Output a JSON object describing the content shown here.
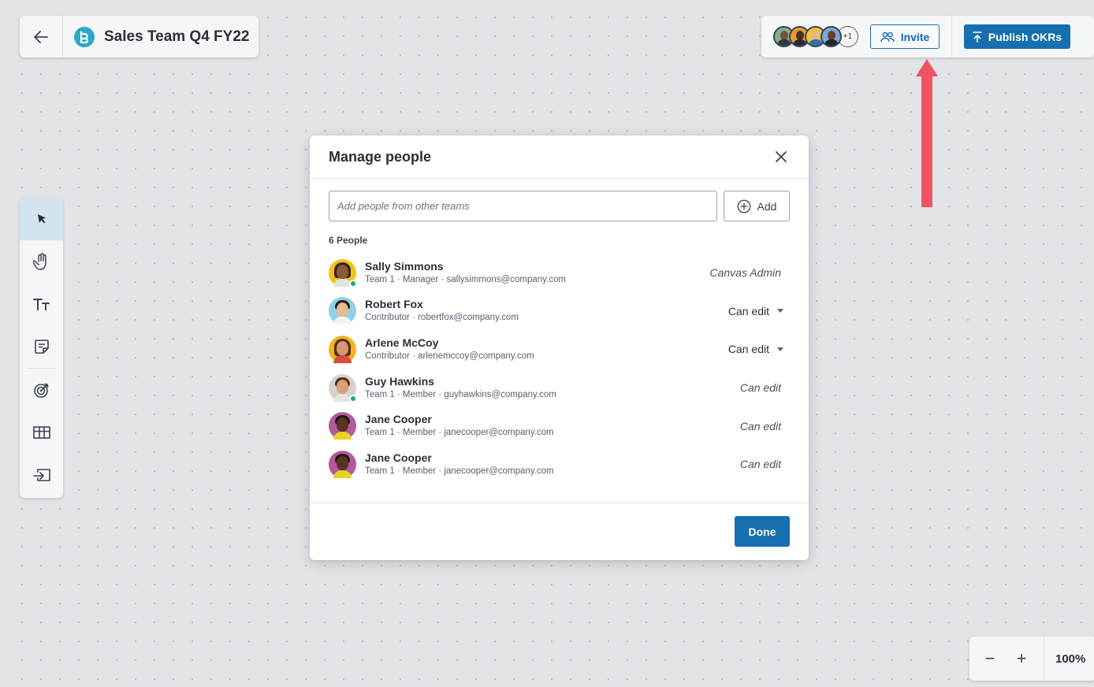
{
  "board": {
    "title": "Sales Team Q4 FY22"
  },
  "header": {
    "extra_collaborators": "+1",
    "invite_label": "Invite",
    "publish_label": "Publish OKRs"
  },
  "zoom": {
    "level": "100%",
    "minus": "−",
    "plus": "+"
  },
  "modal": {
    "title": "Manage people",
    "add_placeholder": "Add people from other teams",
    "add_label": "Add",
    "people_count": "6 People",
    "done_label": "Done",
    "people": [
      {
        "name": "Sally Simmons",
        "meta": "Team 1 · Manager · sallysimmons@company.com",
        "role": "Canvas Admin",
        "online": true
      },
      {
        "name": "Robert Fox",
        "meta": "Contributor · robertfox@company.com",
        "role": "Can edit",
        "online": false
      },
      {
        "name": "Arlene McCoy",
        "meta": "Contributor · arlenemccoy@company.com",
        "role": "Can edit",
        "online": false
      },
      {
        "name": "Guy Hawkins",
        "meta": "Team 1 · Member · guyhawkins@company.com",
        "role": "Can edit",
        "online": true
      },
      {
        "name": "Jane Cooper",
        "meta": "Team 1 · Member · janecooper@company.com",
        "role": "Can edit",
        "online": false
      },
      {
        "name": "Jane Cooper",
        "meta": "Team 1 · Member · janecooper@company.com",
        "role": "Can edit",
        "online": false
      }
    ]
  },
  "colors": {
    "accent": "#1670b0",
    "arrow": "#ef5466",
    "online": "#1ea86f",
    "canvas": "#e3e4e8"
  }
}
